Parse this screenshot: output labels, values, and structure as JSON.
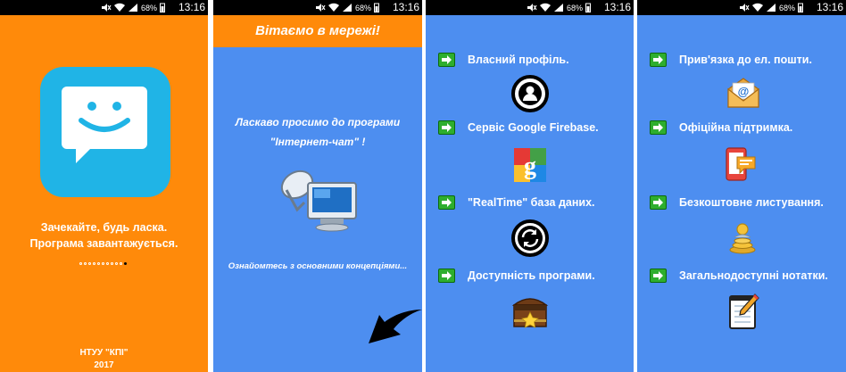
{
  "status_bar": {
    "battery": "68%",
    "time": "13:16"
  },
  "screen1": {
    "message_line1": "Зачекайте, будь ласка.",
    "message_line2": "Програма завантажується.",
    "footer_line1": "НТУУ \"КПІ\"",
    "footer_line2": "2017"
  },
  "screen2": {
    "header": "Вітаємо в мережі!",
    "welcome_line1": "Ласкаво просимо до програми",
    "welcome_line2": "\"Інтернет-чат\" !",
    "hint": "Ознайомтесь з основними концепціями..."
  },
  "screen3": {
    "items": [
      {
        "label": "Власний профіль.",
        "icon": "profile-icon"
      },
      {
        "label": "Сервіс Google Firebase.",
        "icon": "google-icon"
      },
      {
        "label": "\"RealTime\" база даних.",
        "icon": "sync-icon"
      },
      {
        "label": "Доступність програми.",
        "icon": "treasure-chest-icon"
      }
    ]
  },
  "screen4": {
    "items": [
      {
        "label": "Прив'язка до ел. пошти.",
        "icon": "email-icon"
      },
      {
        "label": "Офіційна підтримка.",
        "icon": "support-phone-icon"
      },
      {
        "label": "Безкоштовне листування.",
        "icon": "coins-icon"
      },
      {
        "label": "Загальнодоступні нотатки.",
        "icon": "notepad-icon"
      }
    ]
  }
}
